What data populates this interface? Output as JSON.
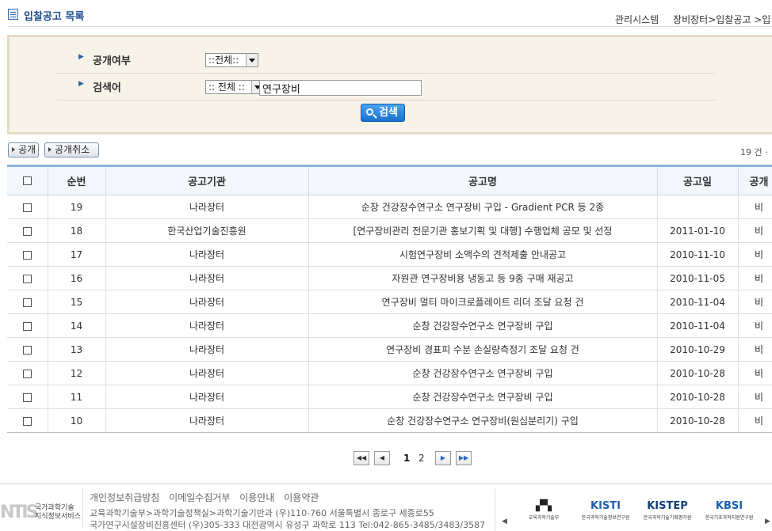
{
  "header": {
    "title": "입찰공고 목록",
    "breadcrumb": [
      "관리시스템",
      "장비장터",
      ">입찰공고",
      ">입"
    ]
  },
  "search": {
    "public_label": "공개여부",
    "public_select": "::전체::",
    "keyword_label": "검색어",
    "keyword_select": ":: 전체 ::",
    "keyword_value": "연구장비",
    "search_button": "검색"
  },
  "actions": {
    "publish": "공개",
    "unpublish": "공개취소",
    "count": "19 건 ·"
  },
  "table": {
    "columns": [
      "순번",
      "공고기관",
      "공고명",
      "공고일",
      "공개"
    ],
    "rows": [
      {
        "no": "19",
        "agency": "나라장터",
        "title": "순창 건강장수연구소 연구장비 구입 - Gradient PCR 등 2종",
        "date": "",
        "pub": "비"
      },
      {
        "no": "18",
        "agency": "한국산업기술진흥원",
        "title": "[연구장비관리 전문기관 홍보기획 및 대행] 수행업체 공모 및 선정",
        "date": "2011-01-10",
        "pub": "비"
      },
      {
        "no": "17",
        "agency": "나라장터",
        "title": "시험연구장비 소액수의 견적제출 안내공고",
        "date": "2010-11-10",
        "pub": "비"
      },
      {
        "no": "16",
        "agency": "나라장터",
        "title": "자원관 연구장비용 냉동고 등 9종 구매 재공고",
        "date": "2010-11-05",
        "pub": "비"
      },
      {
        "no": "15",
        "agency": "나라장터",
        "title": "연구장비 멀티 마이크로플레이트 리더 조달 요청 건",
        "date": "2010-11-04",
        "pub": "비"
      },
      {
        "no": "14",
        "agency": "나라장터",
        "title": "순창 건강장수연구소 연구장비 구입",
        "date": "2010-11-04",
        "pub": "비"
      },
      {
        "no": "13",
        "agency": "나라장터",
        "title": "연구장비 경표피 수분 손실량측정기 조달 요청 건",
        "date": "2010-10-29",
        "pub": "비"
      },
      {
        "no": "12",
        "agency": "나라장터",
        "title": "순창 건강장수연구소 연구장비 구입",
        "date": "2010-10-28",
        "pub": "비"
      },
      {
        "no": "11",
        "agency": "나라장터",
        "title": "순창 건강장수연구소 연구장비 구입",
        "date": "2010-10-28",
        "pub": "비"
      },
      {
        "no": "10",
        "agency": "나라장터",
        "title": "순창 건강장수연구소 연구장비(원심분리기) 구입",
        "date": "2010-10-28",
        "pub": "비"
      }
    ]
  },
  "pagination": {
    "first": "◀◀",
    "prev": "◀",
    "pages": [
      "1",
      "2"
    ],
    "next": "▶",
    "last": "▶▶"
  },
  "footer": {
    "logo_mark": "NTIS",
    "logo_text": [
      "국가과학기술",
      "지식정보서비스"
    ],
    "links": [
      "개인정보취급방침",
      "이메일수집거부",
      "이용안내",
      "이용약관"
    ],
    "address1": "교육과학기술부>과학기술정책실>과학기술기반과 (우)110-760 서울특별시 종로구 세종로55",
    "address2": "국가연구시설장비진흥센터 (우)305-333 대전광역시 유성구 과학로 113 Tel:042-865-3485/3483/3587",
    "banners": [
      {
        "logo": "▞▚",
        "name": "교육과학기술부"
      },
      {
        "logo": "KISTI",
        "name": "한국과학기술정보연구원"
      },
      {
        "logo": "KISTEP",
        "name": "한국과학기술기획평가원"
      },
      {
        "logo": "KBSI",
        "name": "한국기초과학지원연구원"
      }
    ],
    "banner_prev": "◀",
    "banner_next": "▶"
  },
  "colors": {
    "accent": "#1f4e8f",
    "table_top_border": "#8db4dc",
    "search_bg": "#f7f3e8"
  }
}
